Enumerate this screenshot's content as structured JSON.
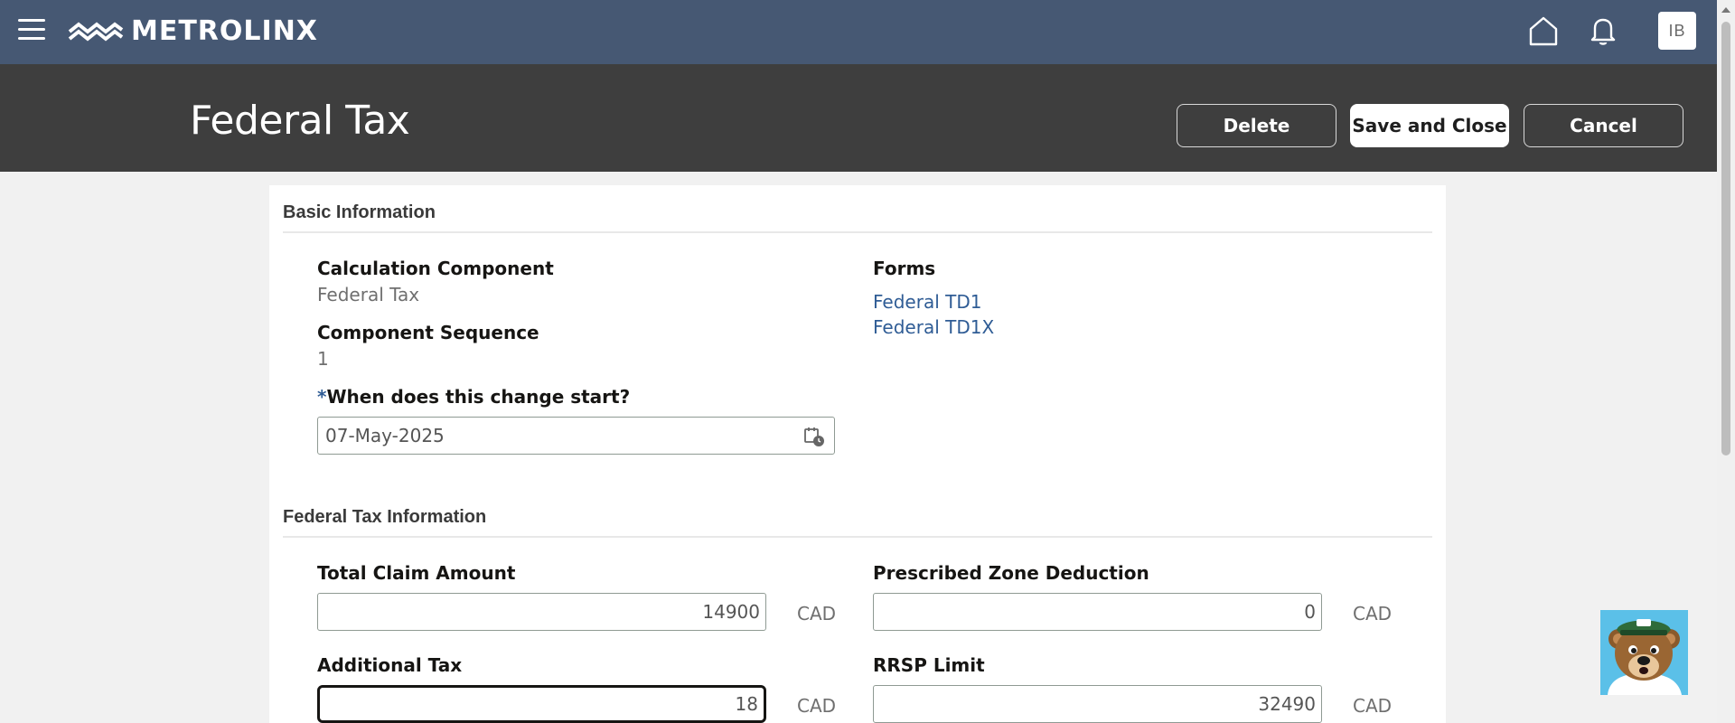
{
  "brand": {
    "name": "METROLINX",
    "accent": "#465873"
  },
  "nav": {
    "avatar_initials": "IB"
  },
  "header": {
    "title": "Federal Tax",
    "delete_label": "Delete",
    "save_label": "Save and Close",
    "cancel_label": "Cancel"
  },
  "basic": {
    "section_title": "Basic Information",
    "calc_component_label": "Calculation Component",
    "calc_component_value": "Federal Tax",
    "sequence_label": "Component Sequence",
    "sequence_value": "1",
    "start_required_mark": "*",
    "start_label": "When does this change start?",
    "start_value": "07-May-2025",
    "forms_label": "Forms",
    "forms": [
      "Federal TD1",
      "Federal TD1X"
    ]
  },
  "fedtax": {
    "section_title": "Federal Tax Information",
    "total_claim_label": "Total Claim Amount",
    "total_claim_value": "14900",
    "zone_label": "Prescribed Zone Deduction",
    "zone_value": "0",
    "additional_label": "Additional Tax",
    "additional_value": "18",
    "rrsp_label": "RRSP Limit",
    "rrsp_value": "32490",
    "currency": "CAD"
  }
}
